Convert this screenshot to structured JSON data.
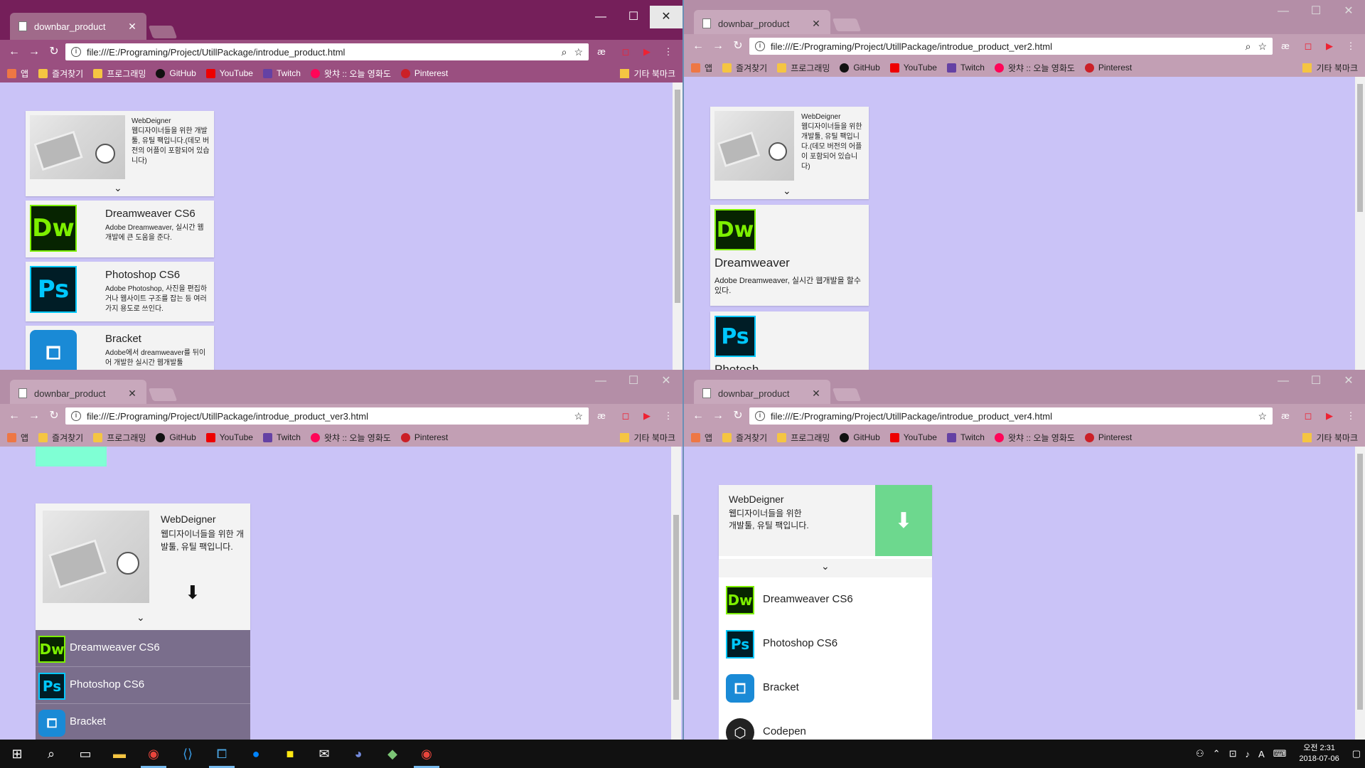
{
  "windows": [
    {
      "tab_title": "downbar_product",
      "url": "file:///E:/Programing/Project/UtillPackage/introdue_product.html",
      "product": {
        "header_title": "WebDeigner",
        "header_desc": "웹디자이너들을 위한 개발툴, 유틸 팩입니다.(데모 버전의 어플이 포함되어 있습니다)",
        "items": [
          {
            "logo": "Dw",
            "name": "Dreamweaver CS6",
            "desc": "Adobe Dreamweaver, 실시간 웹개발에 큰 도움을 준다."
          },
          {
            "logo": "Ps",
            "name": "Photoshop CS6",
            "desc": "Adobe Photoshop, 사진을 편집하거나 웹사이트 구조를 잡는 등 여러가지 용도로 쓰인다."
          },
          {
            "logo": "Br",
            "name": "Bracket",
            "desc": "Adobe에서 dreamweaver를 뒤이어 개발한 실시간 웹개발툴"
          }
        ]
      }
    },
    {
      "tab_title": "downbar_product",
      "url": "file:///E:/Programing/Project/UtillPackage/introdue_product_ver2.html",
      "product": {
        "header_title": "WebDeigner",
        "header_desc": "웹디자이너들을 위한 개발툴, 유틸 팩입니다.(데모 버전의 어플이 포함되어 있습니다)",
        "items": [
          {
            "logo": "Dw",
            "name": "Dreamweaver",
            "desc": "Adobe Dreamweaver, 실시간 웹개발을 할수있다."
          },
          {
            "logo": "Ps",
            "name": "Photosh",
            "desc": ""
          }
        ]
      }
    },
    {
      "tab_title": "downbar_product",
      "url": "file:///E:/Programing/Project/UtillPackage/introdue_product_ver3.html",
      "product": {
        "header_title": "WebDeigner",
        "header_desc": "웹디자이너들을 위한 개발툴, 유틸 팩입니다.",
        "items": [
          {
            "logo": "Dw",
            "name": "Dreamweaver CS6"
          },
          {
            "logo": "Ps",
            "name": "Photoshop CS6"
          },
          {
            "logo": "Br",
            "name": "Bracket"
          }
        ]
      }
    },
    {
      "tab_title": "downbar_product",
      "url": "file:///E:/Programing/Project/UtillPackage/introdue_product_ver4.html",
      "product": {
        "header_title": "WebDeigner",
        "header_desc": "웹디자이너들을 위한 개발툴, 유틸 팩입니다.",
        "items": [
          {
            "logo": "Dw",
            "name": "Dreamweaver CS6"
          },
          {
            "logo": "Ps",
            "name": "Photoshop CS6"
          },
          {
            "logo": "Br",
            "name": "Bracket"
          },
          {
            "logo": "Cp",
            "name": "Codepen"
          }
        ]
      }
    }
  ],
  "bookmarks": [
    "앱",
    "즐겨찾기",
    "프로그래밍",
    "GitHub",
    "YouTube",
    "Twitch",
    "왓챠 :: 오늘 영화도",
    "Pinterest"
  ],
  "other_bookmarks": "기타 북마크",
  "icons": {
    "back": "back-arrow-icon",
    "forward": "forward-arrow-icon",
    "reload": "reload-icon",
    "star": "star-icon",
    "search": "search-icon",
    "download": "download-icon",
    "chevron": "chevron-down-icon"
  },
  "colors": {
    "active_titlebar": "#751f5a",
    "inactive_titlebar": "#b48ea7",
    "page_background": "#cac3f7",
    "v3_list_background": "#7a6e8c",
    "v4_download_button": "#6dd88e",
    "v3_mint_block": "#7fffd4"
  },
  "taskbar": {
    "clock_time": "오전 2:31",
    "clock_date": "2018-07-06",
    "ime": "A"
  }
}
